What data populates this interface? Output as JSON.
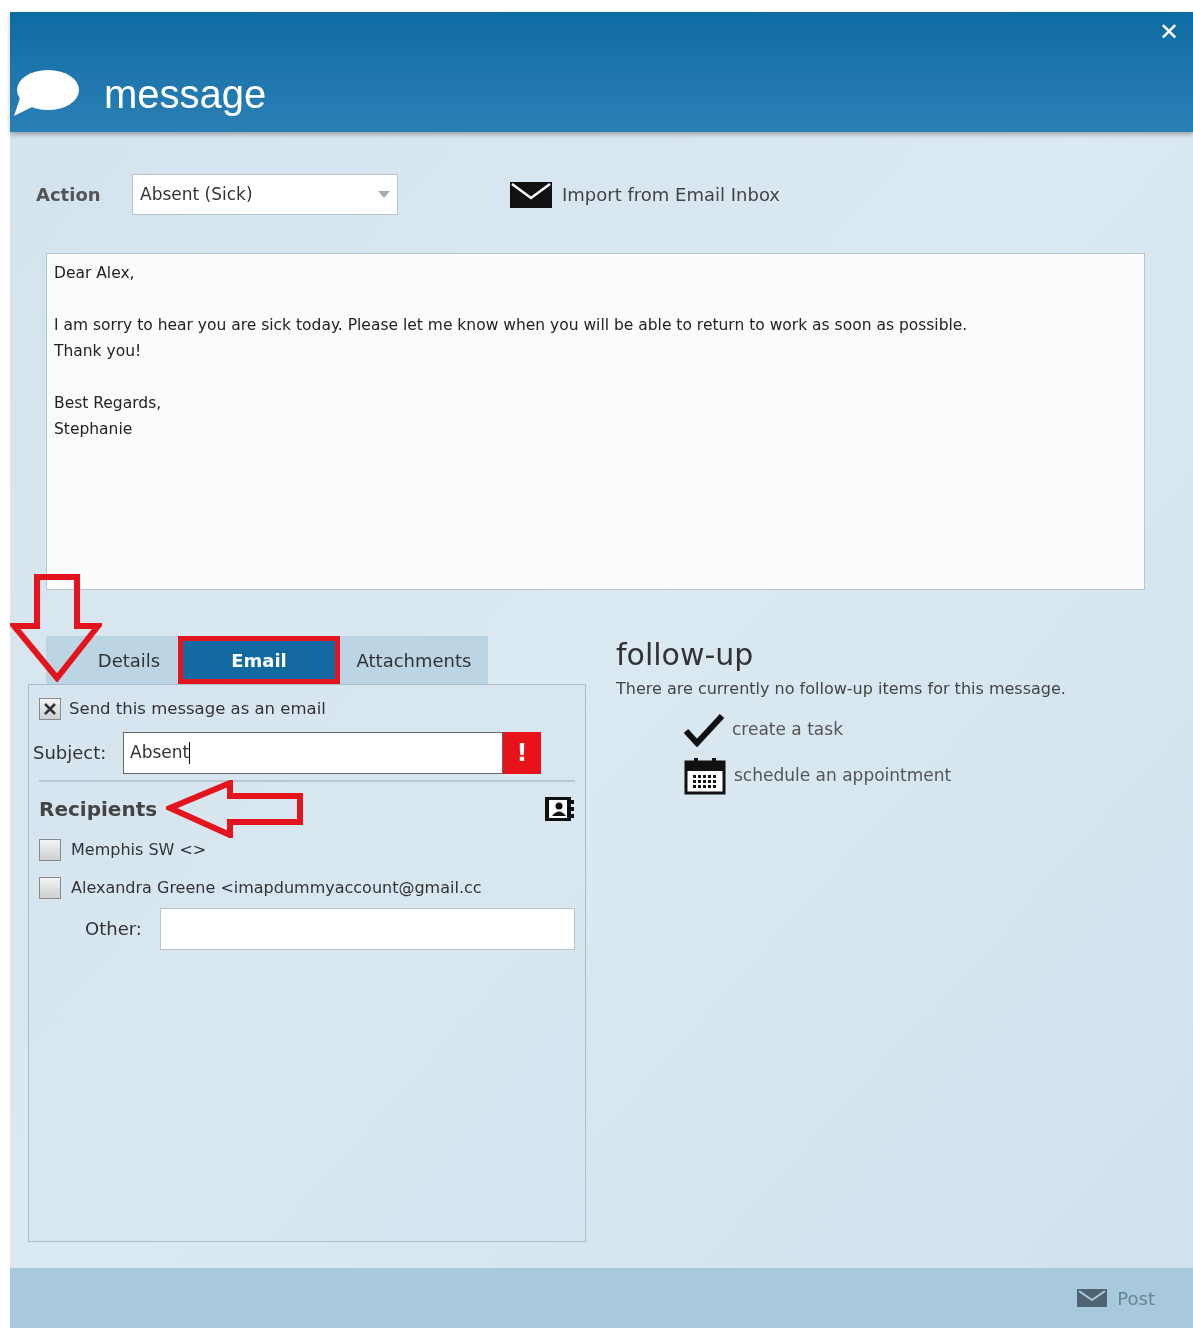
{
  "window": {
    "title": "message",
    "close": "✕"
  },
  "action": {
    "label": "Action",
    "value": "Absent (Sick)"
  },
  "import_link": "Import from Email Inbox",
  "message_body": [
    [
      "Dear Alex,"
    ],
    [
      "I am sorry to hear you are sick today. Please let me know when you will be able to return to work as soon as possible.",
      "Thank you!"
    ],
    [
      "Best Regards,",
      "Stephanie"
    ]
  ],
  "tabs": [
    {
      "label": "Details",
      "selected": false,
      "highlighted": false,
      "arrow_pointer": true
    },
    {
      "label": "Email",
      "selected": true,
      "highlighted": true,
      "arrow_pointer": false
    },
    {
      "label": "Attachments",
      "selected": false,
      "highlighted": false,
      "arrow_pointer": false
    }
  ],
  "email": {
    "send_as_email": {
      "label": "Send this message as an email",
      "checked": true
    },
    "subject": {
      "label": "Subject:",
      "value": "Absent",
      "error": "!"
    },
    "recipients_title": "Recipients",
    "recipients_arrow_pointer": true,
    "recipients": [
      {
        "label": "Memphis SW <>",
        "checked": false
      },
      {
        "label": "Alexandra Greene <imapdummyaccount@gmail.cc",
        "checked": false
      }
    ],
    "other": {
      "label": "Other:"
    }
  },
  "follow_up": {
    "title": "follow-up",
    "text": "There are currently no follow-up items for this message.",
    "actions": [
      {
        "kind": "task",
        "label": "create a task"
      },
      {
        "kind": "appointment",
        "label": "schedule an appointment"
      }
    ]
  },
  "footer": {
    "post": "Post"
  }
}
